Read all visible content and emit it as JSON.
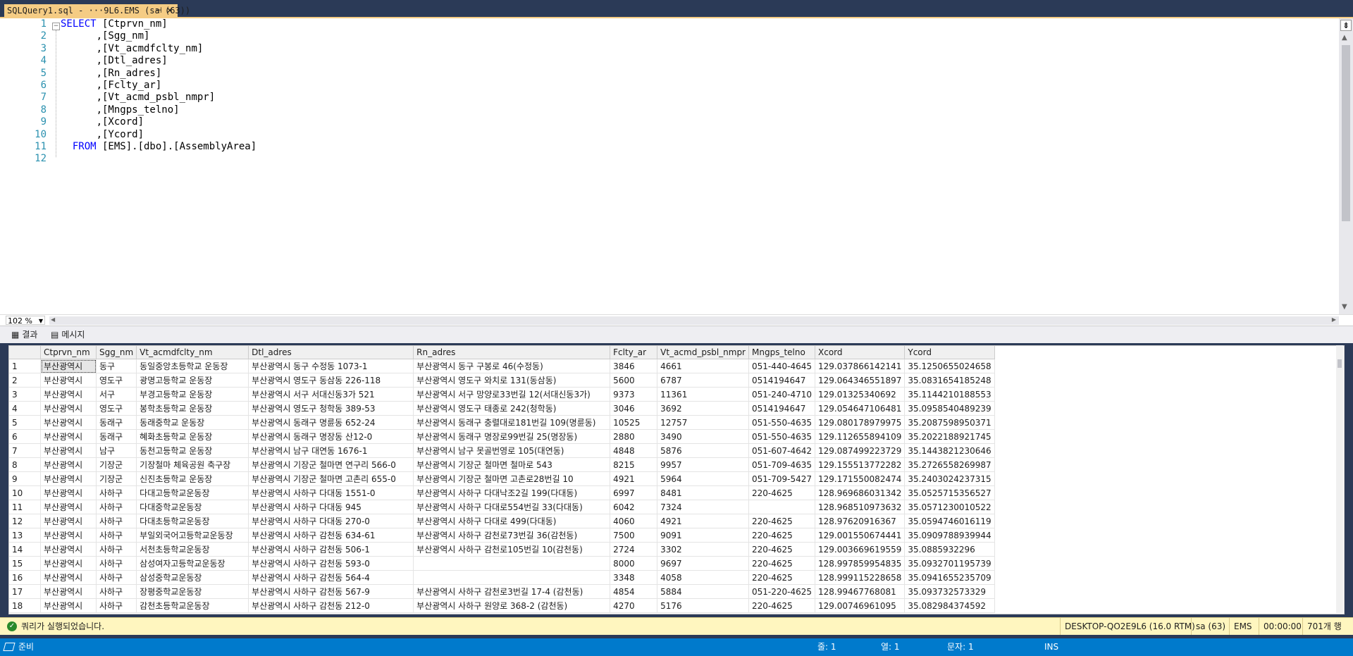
{
  "tab": {
    "title": "SQLQuery1.sql - ···9L6.EMS (sa (63))",
    "pin": "⊣",
    "close": "✕"
  },
  "editor": {
    "line_numbers": [
      "1",
      "2",
      "3",
      "4",
      "5",
      "6",
      "7",
      "8",
      "9",
      "10",
      "11",
      "12"
    ],
    "lines": [
      {
        "indent": "",
        "kw": "SELECT",
        "rest": " [Ctprvn_nm]"
      },
      {
        "indent": "      ",
        "kw": "",
        "rest": ",[Sgg_nm]"
      },
      {
        "indent": "      ",
        "kw": "",
        "rest": ",[Vt_acmdfclty_nm]"
      },
      {
        "indent": "      ",
        "kw": "",
        "rest": ",[Dtl_adres]"
      },
      {
        "indent": "      ",
        "kw": "",
        "rest": ",[Rn_adres]"
      },
      {
        "indent": "      ",
        "kw": "",
        "rest": ",[Fclty_ar]"
      },
      {
        "indent": "      ",
        "kw": "",
        "rest": ",[Vt_acmd_psbl_nmpr]"
      },
      {
        "indent": "      ",
        "kw": "",
        "rest": ",[Mngps_telno]"
      },
      {
        "indent": "      ",
        "kw": "",
        "rest": ",[Xcord]"
      },
      {
        "indent": "      ",
        "kw": "",
        "rest": ",[Ycord]"
      },
      {
        "indent": "  ",
        "kw": "FROM",
        "rest": " [EMS].[dbo].[AssemblyArea]"
      },
      {
        "indent": "",
        "kw": "",
        "rest": ""
      }
    ],
    "zoom": "102 %"
  },
  "result_tabs": {
    "results": "결과",
    "messages": "메시지"
  },
  "grid": {
    "columns": [
      "Ctprvn_nm",
      "Sgg_nm",
      "Vt_acmdfclty_nm",
      "Dtl_adres",
      "Rn_adres",
      "Fclty_ar",
      "Vt_acmd_psbl_nmpr",
      "Mngps_telno",
      "Xcord",
      "Ycord"
    ],
    "rows": [
      [
        "1",
        "부산광역시",
        "동구",
        "동일중앙초등학교 운동장",
        "부산광역시 동구 수정동   1073-1",
        "부산광역시 동구 구봉로 46(수정동)",
        "3846",
        "4661",
        "051-440-4645",
        "129.037866142141",
        "35.1250655024658"
      ],
      [
        "2",
        "부산광역시",
        "영도구",
        "광명고등학교 운동장",
        "부산광역시 영도구 동삼동   226-118",
        "부산광역시 영도구 와치로 131(동삼동)",
        "5600",
        "6787",
        "0514194647",
        "129.064346551897",
        "35.0831654185248"
      ],
      [
        "3",
        "부산광역시",
        "서구",
        "부경고등학교 운동장",
        "부산광역시 서구 서대신동3가   521",
        "부산광역시 서구 망양로33번길 12(서대신동3가)",
        "9373",
        "11361",
        "051-240-4710",
        "129.01325340692",
        "35.1144210188553"
      ],
      [
        "4",
        "부산광역시",
        "영도구",
        "봉학초등학교 운동장",
        "부산광역시 영도구 청학동   389-53",
        "부산광역시 영도구 태종로 242(청학동)",
        "3046",
        "3692",
        "0514194647",
        "129.054647106481",
        "35.0958540489239"
      ],
      [
        "5",
        "부산광역시",
        "동래구",
        "동래중학교 운동장",
        "부산광역시 동래구 명륜동   652-24",
        "부산광역시 동래구 충렬대로181번길 109(명륜동)",
        "10525",
        "12757",
        "051-550-4635",
        "129.080178979975",
        "35.2087598950371"
      ],
      [
        "6",
        "부산광역시",
        "동래구",
        "혜화초등학교 운동장",
        "부산광역시 동래구 명장동   산12-0",
        "부산광역시 동래구 명장로99번길 25(명장동)",
        "2880",
        "3490",
        "051-550-4635",
        "129.112655894109",
        "35.2022188921745"
      ],
      [
        "7",
        "부산광역시",
        "남구",
        "동천고등학교 운동장",
        "부산광역시 남구 대연동   1676-1",
        "부산광역시 남구 못골번영로 105(대연동)",
        "4848",
        "5876",
        "051-607-4642",
        "129.087499223729",
        "35.1443821230646"
      ],
      [
        "8",
        "부산광역시",
        "기장군",
        "기장철마 체육공원 축구장",
        "부산광역시 기장군 철마면 연구리 566-0",
        "부산광역시 기장군 철마면 철마로 543",
        "8215",
        "9957",
        "051-709-4635",
        "129.155513772282",
        "35.2726558269987"
      ],
      [
        "9",
        "부산광역시",
        "기장군",
        "신진초등학교 운동장",
        "부산광역시 기장군 철마면 고촌리 655-0",
        "부산광역시 기장군 철마면 고촌로28번길 10",
        "4921",
        "5964",
        "051-709-5427",
        "129.171550082474",
        "35.2403024237315"
      ],
      [
        "10",
        "부산광역시",
        "사하구",
        "다대고등학교운동장",
        "부산광역시 사하구 다대동   1551-0",
        "부산광역시 사하구 다대낙조2길 199(다대동)",
        "6997",
        "8481",
        "220-4625",
        "128.969686031342",
        "35.0525715356527"
      ],
      [
        "11",
        "부산광역시",
        "사하구",
        "다대중학교운동장",
        "부산광역시 사하구 다대동   945",
        "부산광역시 사하구 다대로554번길 33(다대동)",
        "6042",
        "7324",
        "",
        "128.968510973632",
        "35.0571230010522"
      ],
      [
        "12",
        "부산광역시",
        "사하구",
        "다대초등학교운동장",
        "부산광역시 사하구 다대동   270-0",
        "부산광역시 사하구 다대로 499(다대동)",
        "4060",
        "4921",
        "220-4625",
        "128.97620916367",
        "35.0594746016119"
      ],
      [
        "13",
        "부산광역시",
        "사하구",
        "부일외국어고등학교운동장",
        "부산광역시 사하구 감천동   634-61",
        "부산광역시 사하구 감천로73번길 36(감천동)",
        "7500",
        "9091",
        "220-4625",
        "129.001550674441",
        "35.0909788939944"
      ],
      [
        "14",
        "부산광역시",
        "사하구",
        "서천초등학교운동장",
        "부산광역시 사하구 감천동   506-1",
        "부산광역시 사하구 감천로105번길 10(감천동)",
        "2724",
        "3302",
        "220-4625",
        "129.003669619559",
        "35.0885932296"
      ],
      [
        "15",
        "부산광역시",
        "사하구",
        "삼성여자고등학교운동장",
        "부산광역시 사하구 감천동   593-0",
        "",
        "8000",
        "9697",
        "220-4625",
        "128.997859954835",
        "35.0932701195739"
      ],
      [
        "16",
        "부산광역시",
        "사하구",
        "삼성중학교운동장",
        "부산광역시 사하구 감천동   564-4",
        "",
        "3348",
        "4058",
        "220-4625",
        "128.999115228658",
        "35.0941655235709"
      ],
      [
        "17",
        "부산광역시",
        "사하구",
        "장평중학교운동장",
        "부산광역시 사하구 감천동   567-9",
        "부산광역시 사하구 감천로3번길 17-4 (감천동)",
        "4854",
        "5884",
        "051-220-4625",
        "128.99467768081",
        "35.093732573329"
      ],
      [
        "18",
        "부산광역시",
        "사하구",
        "감천초등학교운동장",
        "부산광역시 사하구 감천동   212-0",
        "부산광역시 사하구 원양로 368-2 (감천동)",
        "4270",
        "5176",
        "220-4625",
        "129.00746961095",
        "35.082984374592"
      ]
    ]
  },
  "query_status": {
    "message": "쿼리가 실행되었습니다.",
    "server": "DESKTOP-QO2E9L6 (16.0 RTM)",
    "user": "sa (63)",
    "db": "EMS",
    "time": "00:00:00",
    "rows": "701개 행"
  },
  "app_status": {
    "ready": "준비",
    "line": "줄: 1",
    "col": "열: 1",
    "ch": "문자: 1",
    "mode": "INS"
  }
}
